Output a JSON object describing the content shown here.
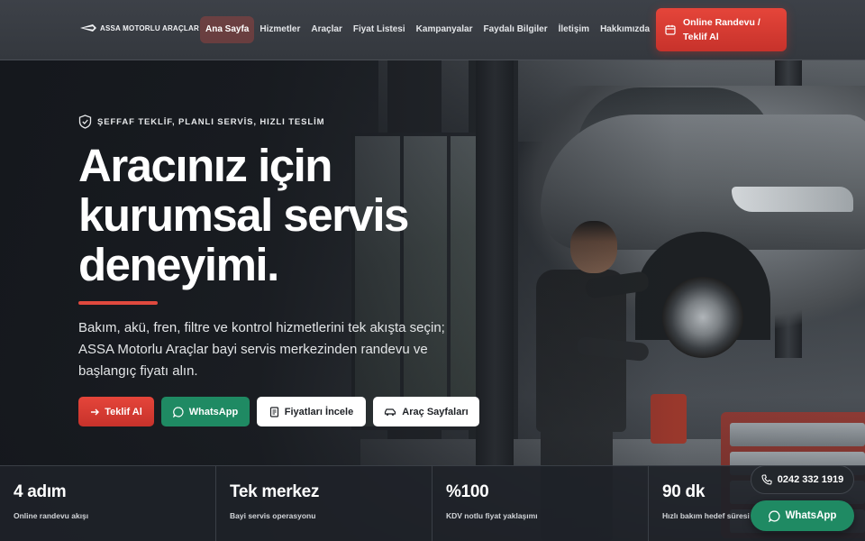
{
  "brand": {
    "name": "ASSA MOTORLU ARAÇLAR"
  },
  "nav": {
    "items": [
      {
        "label": "Ana Sayfa",
        "active": true
      },
      {
        "label": "Hizmetler"
      },
      {
        "label": "Araçlar"
      },
      {
        "label": "Fiyat Listesi"
      },
      {
        "label": "Kampanyalar"
      },
      {
        "label": "Faydalı Bilgiler"
      },
      {
        "label": "İletişim"
      },
      {
        "label": "Hakkımızda"
      }
    ],
    "cta_label": "Online Randevu / Teklif Al"
  },
  "hero": {
    "eyebrow": "ŞEFFAF TEKLİF, PLANLI SERVİS, HIZLI TESLİM",
    "headline": "Aracınız için kurumsal servis deneyimi.",
    "description": "Bakım, akü, fren, filtre ve kontrol hizmetlerini tek akışta seçin; ASSA Motorlu Araçlar bayi servis merkezinden randevu ve başlangıç fiyatı alın.",
    "buttons": [
      {
        "label": "Teklif Al",
        "icon": "arrow-right-icon"
      },
      {
        "label": "WhatsApp",
        "icon": "whatsapp-icon"
      },
      {
        "label": "Fiyatları İncele",
        "icon": "document-icon"
      },
      {
        "label": "Araç Sayfaları",
        "icon": "car-icon"
      }
    ]
  },
  "stats": [
    {
      "value": "4 adım",
      "label": "Online randevu akışı"
    },
    {
      "value": "Tek merkez",
      "label": "Bayi servis operasyonu"
    },
    {
      "value": "%100",
      "label": "KDV notlu fiyat yaklaşımı"
    },
    {
      "value": "90 dk",
      "label": "Hızlı bakım hedef süresi"
    }
  ],
  "floating": {
    "phone": "0242 332 1919",
    "whatsapp": "WhatsApp"
  },
  "colors": {
    "accent": "#e0493e",
    "whatsapp_green": "#1f8a63",
    "header_bg": "#3a3e44",
    "hero_bg": "#1a1d22"
  }
}
